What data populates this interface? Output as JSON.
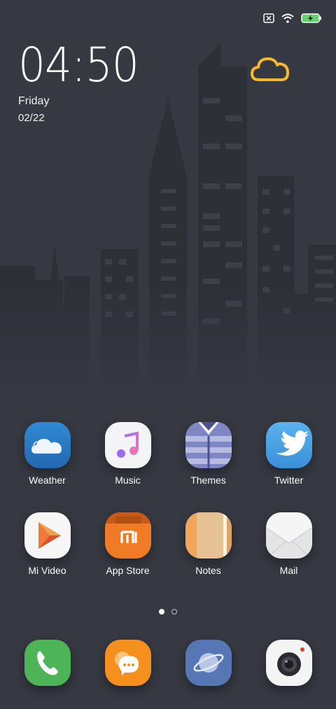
{
  "status_bar": {
    "icons": [
      "no-sim-icon",
      "wifi-icon",
      "battery-charging-icon"
    ]
  },
  "clock": {
    "time": "04:50",
    "day": "Friday",
    "date": "02/22"
  },
  "weather_widget": {
    "icon": "cloud-outline-icon",
    "color": "#F5B92E"
  },
  "apps_row1": [
    {
      "label": "Weather"
    },
    {
      "label": "Music"
    },
    {
      "label": "Themes"
    },
    {
      "label": "Twitter"
    }
  ],
  "apps_row2": [
    {
      "label": "Mi Video"
    },
    {
      "label": "App Store"
    },
    {
      "label": "Notes"
    },
    {
      "label": "Mail"
    }
  ],
  "pager": {
    "pages": 2,
    "current": 1
  },
  "dock": {
    "apps": [
      "phone-icon",
      "messaging-icon",
      "browser-icon",
      "camera-icon"
    ]
  },
  "colors": {
    "background": "#363842",
    "weather": "#2E7CC4",
    "app_store": "#F07B26",
    "phone": "#4DB458",
    "messaging": "#F5901E",
    "browser": "#5677B4"
  }
}
